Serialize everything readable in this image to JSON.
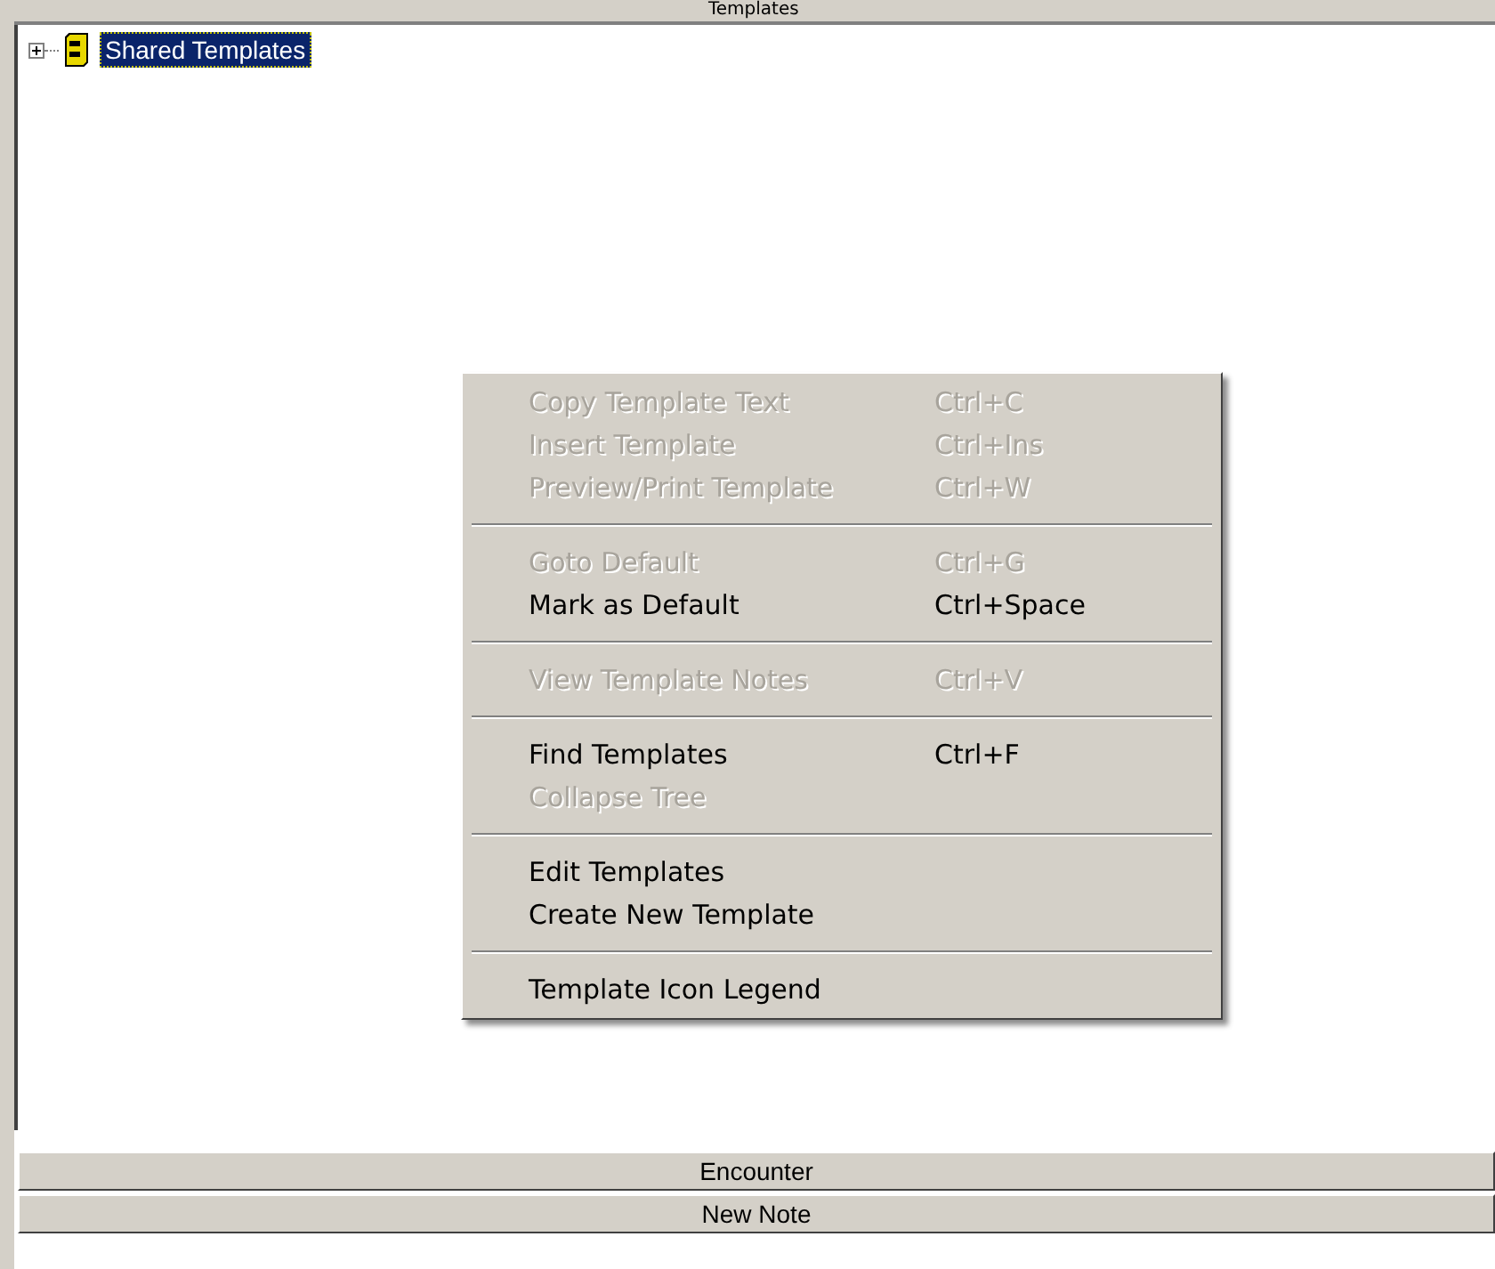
{
  "panel": {
    "title": "Templates"
  },
  "tree": [
    {
      "label": "Shared Templates",
      "expanded": false,
      "selected": true
    }
  ],
  "context_menu": {
    "groups": [
      [
        {
          "label": "Copy Template Text",
          "shortcut": "Ctrl+C",
          "disabled": true
        },
        {
          "label": "Insert Template",
          "shortcut": "Ctrl+Ins",
          "disabled": true
        },
        {
          "label": "Preview/Print Template",
          "shortcut": "Ctrl+W",
          "disabled": true
        }
      ],
      [
        {
          "label": "Goto Default",
          "shortcut": "Ctrl+G",
          "disabled": true
        },
        {
          "label": "Mark as Default",
          "shortcut": "Ctrl+Space",
          "disabled": false
        }
      ],
      [
        {
          "label": "View Template Notes",
          "shortcut": "Ctrl+V",
          "disabled": true
        }
      ],
      [
        {
          "label": "Find Templates",
          "shortcut": "Ctrl+F",
          "disabled": false
        },
        {
          "label": "Collapse Tree",
          "disabled": true
        }
      ],
      [
        {
          "label": "Edit Templates",
          "disabled": false
        },
        {
          "label": "Create New Template",
          "disabled": false
        }
      ],
      [
        {
          "label": "Template Icon Legend",
          "disabled": false
        }
      ]
    ]
  },
  "bottom_bars": [
    "Encounter",
    "New Note"
  ]
}
